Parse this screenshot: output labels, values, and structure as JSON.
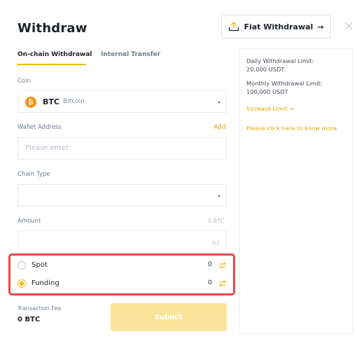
{
  "header": {
    "title": "Withdraw",
    "fiat_button_label": "Fiat Withdrawal",
    "fiat_button_arrow": "→"
  },
  "tabs": [
    {
      "label": "On-chain Withdrawal",
      "active": true
    },
    {
      "label": "Internal Transfer",
      "active": false
    }
  ],
  "form": {
    "coin_label": "Coin",
    "coin_symbol": "BTC",
    "coin_name": "Bitcoin",
    "coin_icon_glyph": "₿",
    "wallet_address_label": "Wallet Address",
    "wallet_address_add_link": "Add",
    "wallet_address_placeholder": "Please enter",
    "chain_type_label": "Chain Type",
    "chain_type_value": "",
    "amount_label": "Amount",
    "amount_unit": "0 BTC",
    "amount_all_button": "All"
  },
  "wallets": [
    {
      "label": "Spot",
      "value": "0",
      "selected": false
    },
    {
      "label": "Funding",
      "value": "0",
      "selected": true
    }
  ],
  "footer": {
    "fee_label": "Transaction Fee",
    "fee_value": "0 BTC",
    "submit_label": "Submit"
  },
  "side_panel": {
    "daily_limit_label": "Daily Withdrawal Limit:",
    "daily_limit_value": "20,000 USDT",
    "monthly_limit_label": "Monthly Withdrawal Limit:",
    "monthly_limit_value": "100,000 USDT",
    "increase_limit_link": "Increase Limit →",
    "help_link": "Please click here to know more"
  },
  "colors": {
    "accent": "#f0b90b",
    "link": "#e0a800",
    "highlight_border": "#e5484d",
    "submit_disabled": "#fbe39a"
  }
}
